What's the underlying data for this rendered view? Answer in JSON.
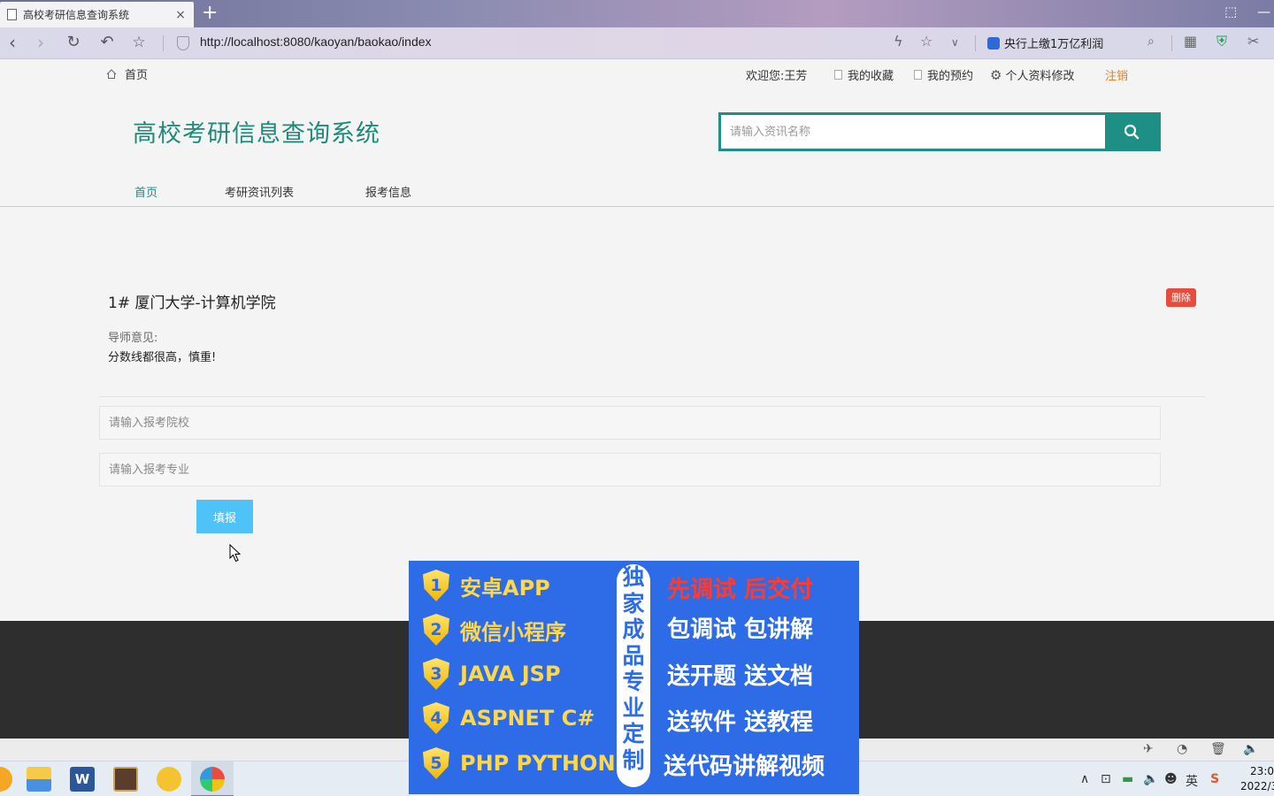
{
  "browser": {
    "tab_title": "高校考研信息查询系统",
    "url": "http://localhost:8080/kaoyan/baokao/index",
    "news_text": "央行上缴1万亿利润"
  },
  "topbar": {
    "home": "首页",
    "welcome": "欢迎您:王芳",
    "favorites": "我的收藏",
    "reservations": "我的预约",
    "profile": "个人资料修改",
    "logout": "注销"
  },
  "header": {
    "site_title": "高校考研信息查询系统",
    "search_placeholder": "请输入资讯名称"
  },
  "nav": {
    "items": [
      {
        "label": "首页",
        "active": true
      },
      {
        "label": "考研资讯列表",
        "active": false
      },
      {
        "label": "报考信息",
        "active": false
      }
    ]
  },
  "record": {
    "title": "1# 厦门大学-计算机学院",
    "delete_label": "删除",
    "opinion_label": "导师意见:",
    "opinion_text": "分数线都很高，慎重!"
  },
  "form": {
    "school_placeholder": "请输入报考院校",
    "major_placeholder": "请输入报考专业",
    "submit_label": "填报"
  },
  "ad": {
    "items": [
      {
        "num": "1",
        "label": "安卓APP"
      },
      {
        "num": "2",
        "label": "微信小程序"
      },
      {
        "num": "3",
        "label": "JAVA JSP"
      },
      {
        "num": "4",
        "label": "ASPNET C#"
      },
      {
        "num": "5",
        "label": "PHP PYTHON"
      }
    ],
    "vertical": [
      "独",
      "家",
      "成",
      "品",
      "专",
      "业",
      "定",
      "制"
    ],
    "right_lines": [
      "先调试 后交付",
      "包调试 包讲解",
      "送开题 送文档",
      "送软件 送教程",
      "送代码讲解视频"
    ],
    "colors": {
      "background": "#2e6be6",
      "highlight": "#ff3b30",
      "text": "#ffffff",
      "item": "#ffd84a"
    }
  },
  "taskbar": {
    "clock_time": "23:0",
    "clock_date": "2022/3",
    "ime": "英"
  },
  "colors": {
    "brand": "#1d8f84",
    "delete": "#e74c3c",
    "submit": "#4fc3f7",
    "logout": "#e67e22",
    "footer": "#2e2e2e"
  }
}
